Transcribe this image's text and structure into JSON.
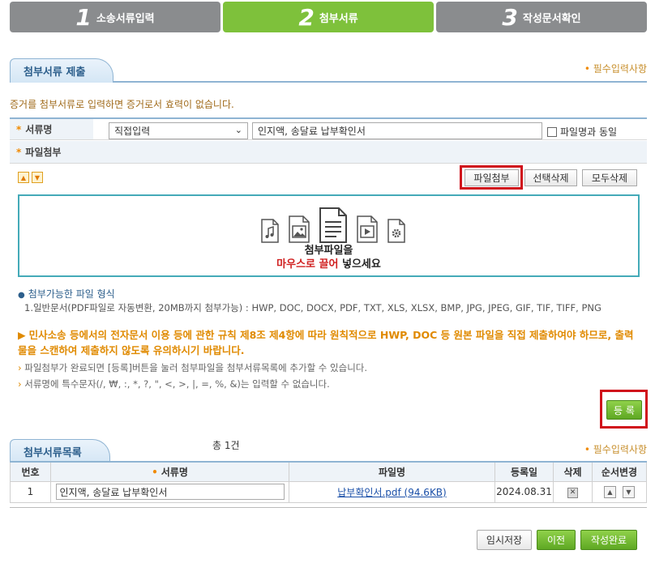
{
  "steps": [
    {
      "num": "1",
      "label": "소송서류입력"
    },
    {
      "num": "2",
      "label": "첨부서류"
    },
    {
      "num": "3",
      "label": "작성문서확인"
    }
  ],
  "section1": {
    "title": "첨부서류 제출",
    "required_note": "필수입력사항"
  },
  "notice": "증거를 첨부서류로 입력하면 증거로서 효력이 없습니다.",
  "doc_name_row": {
    "label": "서류명",
    "select_value": "직접입력",
    "input_value": "인지액, 송달료 납부확인서",
    "checkbox_label": "파일명과 동일"
  },
  "attach_row": {
    "label": "파일첨부"
  },
  "buttons": {
    "attach": "파일첨부",
    "delete_selected": "선택삭제",
    "delete_all": "모두삭제",
    "register": "등 록"
  },
  "dropzone": {
    "line1": "첨부파일을",
    "line2_red": "마우스로 끌어",
    "line2_rest": " 넣으세요"
  },
  "formats": {
    "title": "첨부가능한 파일 형식",
    "line": "1.일반문서(PDF파일로 자동변환, 20MB까지 첨부가능) : HWP, DOC, DOCX, PDF, TXT, XLS, XLSX, BMP, JPG, JPEG, GIF, TIF, TIFF, PNG"
  },
  "warning": "민사소송 등에서의 전자문서 이용 등에 관한 규칙 제8조 제4항에 따라 원칙적으로 HWP, DOC 등 원본 파일을 직접 제출하여야 하므로, 출력물을 스캔하여 제출하지 않도록 유의하시기 바랍니다.",
  "info1": "파일첨부가 완료되면 [등록]버튼을 눌러 첨부파일을 첨부서류목록에 추가할 수 있습니다.",
  "info2": "서류명에 특수문자(/, ₩, :, *, ?, \", <, >, |, =, %, &)는 입력할 수 없습니다.",
  "section2": {
    "title": "첨부서류목록",
    "count": "총 1건",
    "required_note": "필수입력사항"
  },
  "table": {
    "headers": {
      "no": "번호",
      "doc_name": "서류명",
      "file_name": "파일명",
      "date": "등록일",
      "delete": "삭제",
      "order": "순서변경"
    },
    "rows": [
      {
        "no": "1",
        "doc_name": "인지액, 송달료 납부확인서",
        "file_name": "납부확인서.pdf (94.6KB)",
        "date": "2024.08.31"
      }
    ]
  },
  "footer": {
    "temp_save": "임시저장",
    "prev": "이전",
    "complete": "작성완료"
  },
  "colors": {
    "active_step": "#7ec13b",
    "inactive_step": "#8a8c8e",
    "highlight": "#d0101a",
    "accent_blue": "#2d5f8c"
  }
}
